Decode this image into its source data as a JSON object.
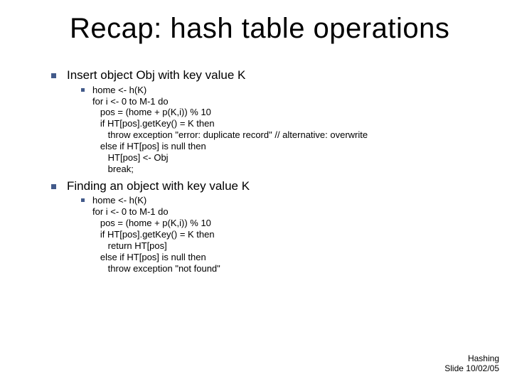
{
  "title": "Recap:  hash table operations",
  "bullets": [
    {
      "text": "Insert object Obj with key value K",
      "code": "home <- h(K)\nfor i <- 0 to M-1 do\n   pos = (home + p(K,i)) % 10\n   if HT[pos].getKey() = K then\n      throw exception \"error: duplicate record\" // alternative: overwrite\n   else if HT[pos] is null then\n      HT[pos] <- Obj\n      break;"
    },
    {
      "text": "Finding an object with key value K",
      "code": "home <- h(K)\nfor i <- 0 to M-1 do\n   pos = (home + p(K,i)) % 10\n   if HT[pos].getKey() = K then\n      return HT[pos]\n   else if HT[pos] is null then\n      throw exception \"not found\""
    }
  ],
  "footer": {
    "line1": "Hashing",
    "line2": "Slide 10/02/05"
  }
}
